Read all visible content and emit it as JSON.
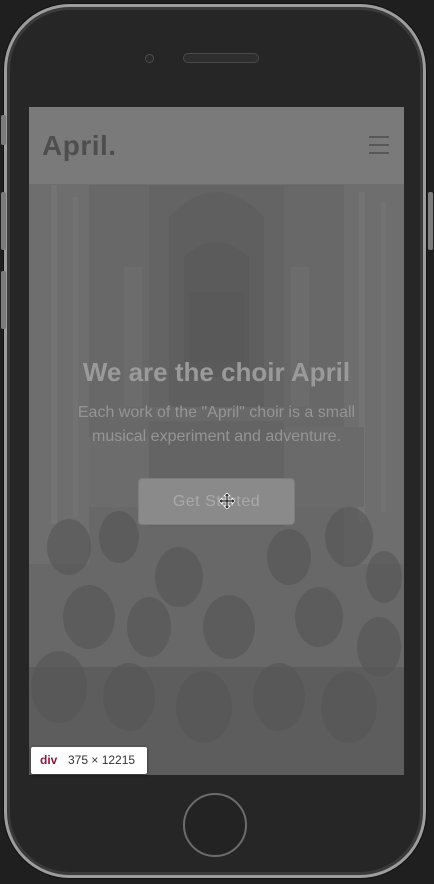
{
  "app": {
    "logo": "April."
  },
  "hero": {
    "title": "We are the choir April",
    "subtitle": "Each work of the \"April\" choir is a small musical experiment and adventure.",
    "cta_label": "Get Started"
  },
  "inspector": {
    "tag": "div",
    "size": "375 × 12215"
  },
  "icons": {
    "menu": "hamburger-menu-icon",
    "cursor": "move-cursor-icon"
  },
  "colors": {
    "overlay": "#6b6b6b",
    "topbar": "#7a7a7a",
    "inspector_tag": "#8a1a3b"
  }
}
